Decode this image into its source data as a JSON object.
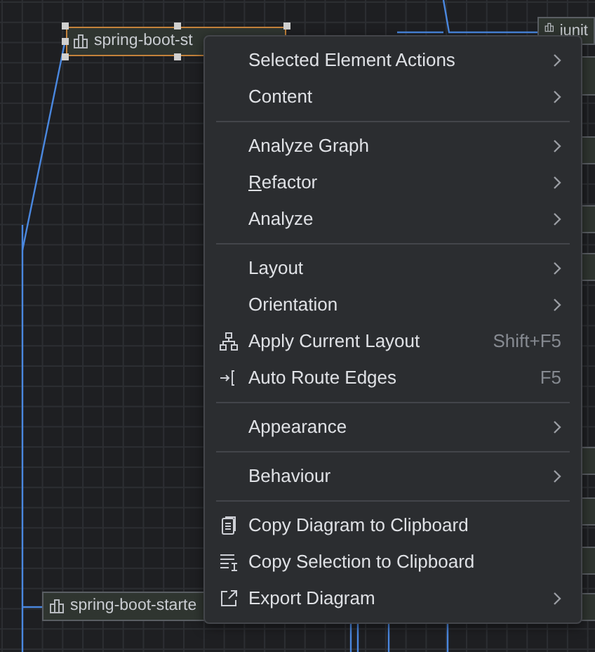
{
  "canvas": {
    "nodes": [
      {
        "label": "spring-boot-st",
        "selected": true
      },
      {
        "label": "spring-boot-starte",
        "selected": false
      },
      {
        "label": "junit",
        "selected": false
      }
    ]
  },
  "context_menu": {
    "groups": [
      [
        {
          "label": "Selected Element Actions",
          "submenu": true
        },
        {
          "label": "Content",
          "submenu": true
        }
      ],
      [
        {
          "label": "Analyze Graph",
          "submenu": true
        },
        {
          "label": "Refactor",
          "submenu": true,
          "mnemonic_first": true
        },
        {
          "label": "Analyze",
          "submenu": true
        }
      ],
      [
        {
          "label": "Layout",
          "submenu": true
        },
        {
          "label": "Orientation",
          "submenu": true
        },
        {
          "label": "Apply Current Layout",
          "shortcut": "Shift+F5",
          "submenu": false
        },
        {
          "label": "Auto Route Edges",
          "shortcut": "F5",
          "submenu": false
        }
      ],
      [
        {
          "label": "Appearance",
          "submenu": true
        }
      ],
      [
        {
          "label": "Behaviour",
          "submenu": true
        }
      ],
      [
        {
          "label": "Copy Diagram to Clipboard",
          "submenu": false
        },
        {
          "label": "Copy Selection to Clipboard",
          "submenu": false
        },
        {
          "label": "Export Diagram",
          "submenu": true
        }
      ]
    ]
  }
}
